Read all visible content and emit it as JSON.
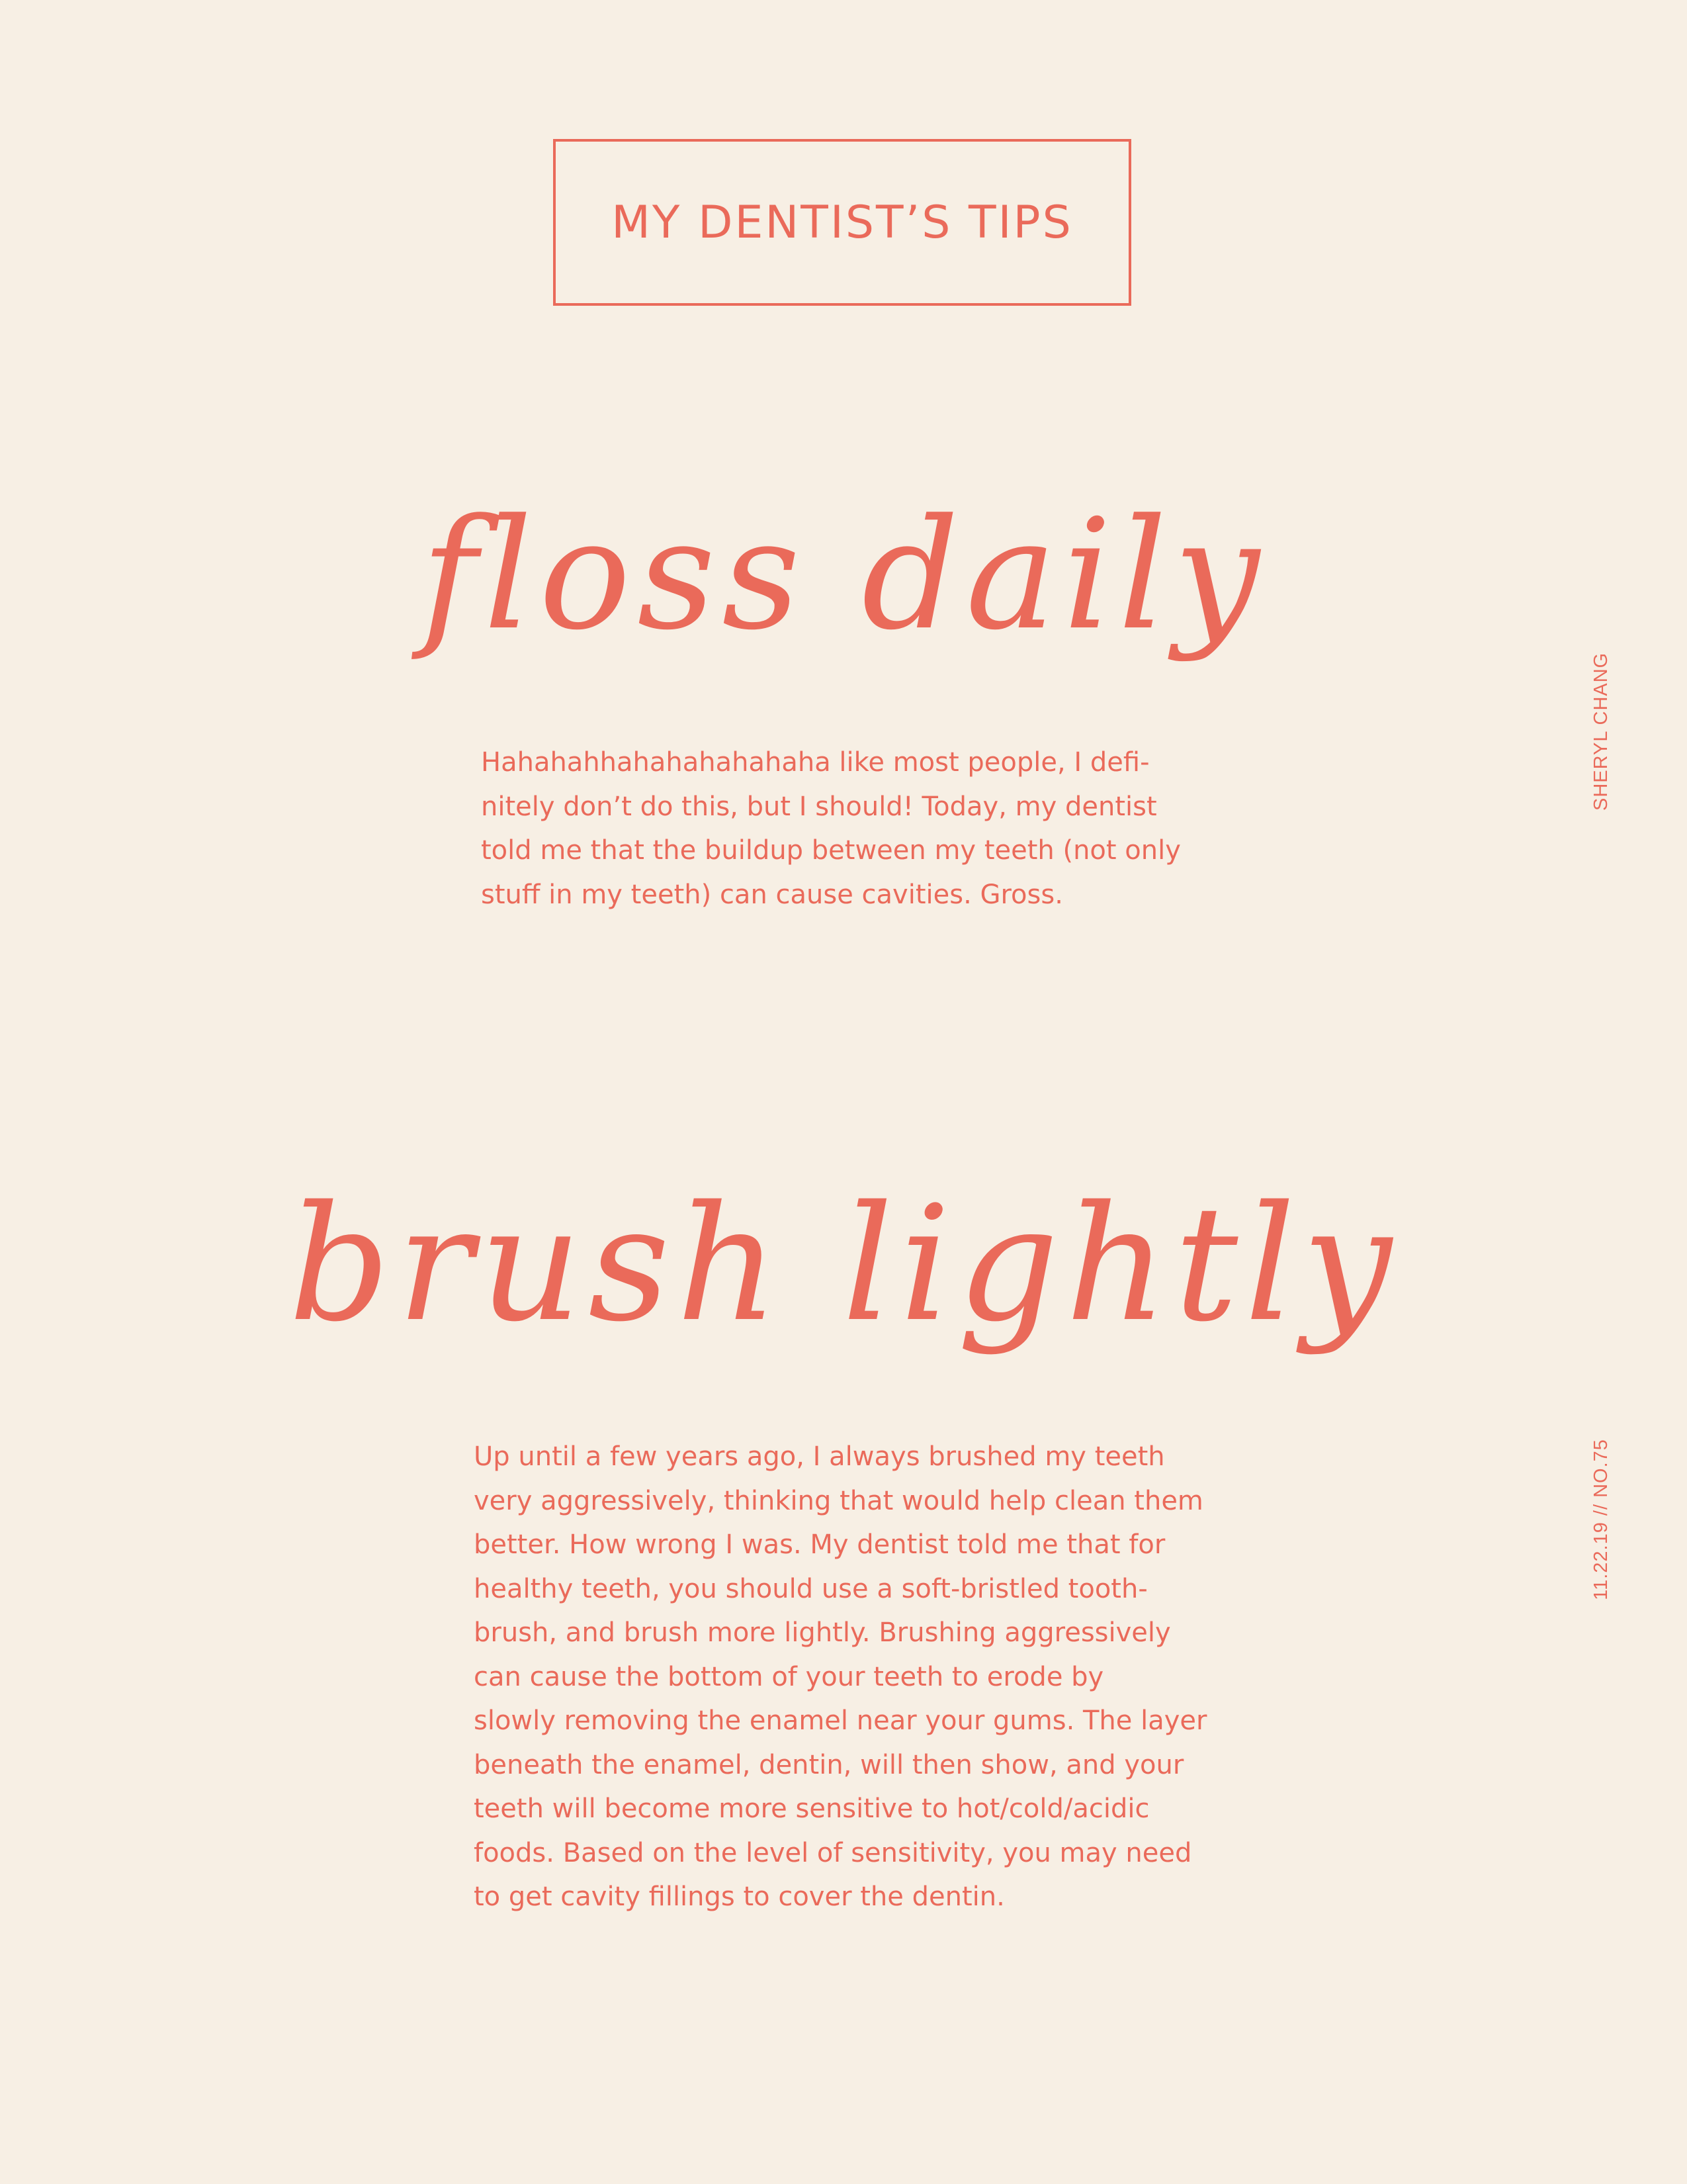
{
  "header": {
    "title": "MY DENTIST’S TIPS"
  },
  "sections": [
    {
      "heading": "floss daily",
      "body_lines": [
        "Hahahahhahahahahahaha like most people, I defi-",
        "nitely don’t do this, but I should! Today, my dentist",
        "told me that the buildup between my teeth (not only",
        "stuff in my teeth) can cause cavities. Gross."
      ]
    },
    {
      "heading": "brush lightly",
      "body_lines": [
        "Up until a few years ago, I always brushed my teeth",
        "very aggressively, thinking that would help clean them",
        "better. How wrong I was. My dentist told me that for",
        "healthy teeth, you should use a soft-bristled tooth-",
        "brush, and brush more lightly. Brushing aggressively",
        "can cause the bottom of your teeth to erode by",
        "slowly removing the enamel near your gums. The layer",
        "beneath the enamel, dentin, will then show, and your",
        "teeth will become more sensitive to hot/cold/acidic",
        "foods. Based on the level of sensitivity, you may need",
        "to get cavity fillings to cover the dentin."
      ]
    }
  ],
  "sidebar": {
    "author": "SHERYL CHANG",
    "issue": "11.22.19 // NO.75"
  },
  "colors": {
    "background": "#f7efe4",
    "accent": "#ea6a5a"
  }
}
